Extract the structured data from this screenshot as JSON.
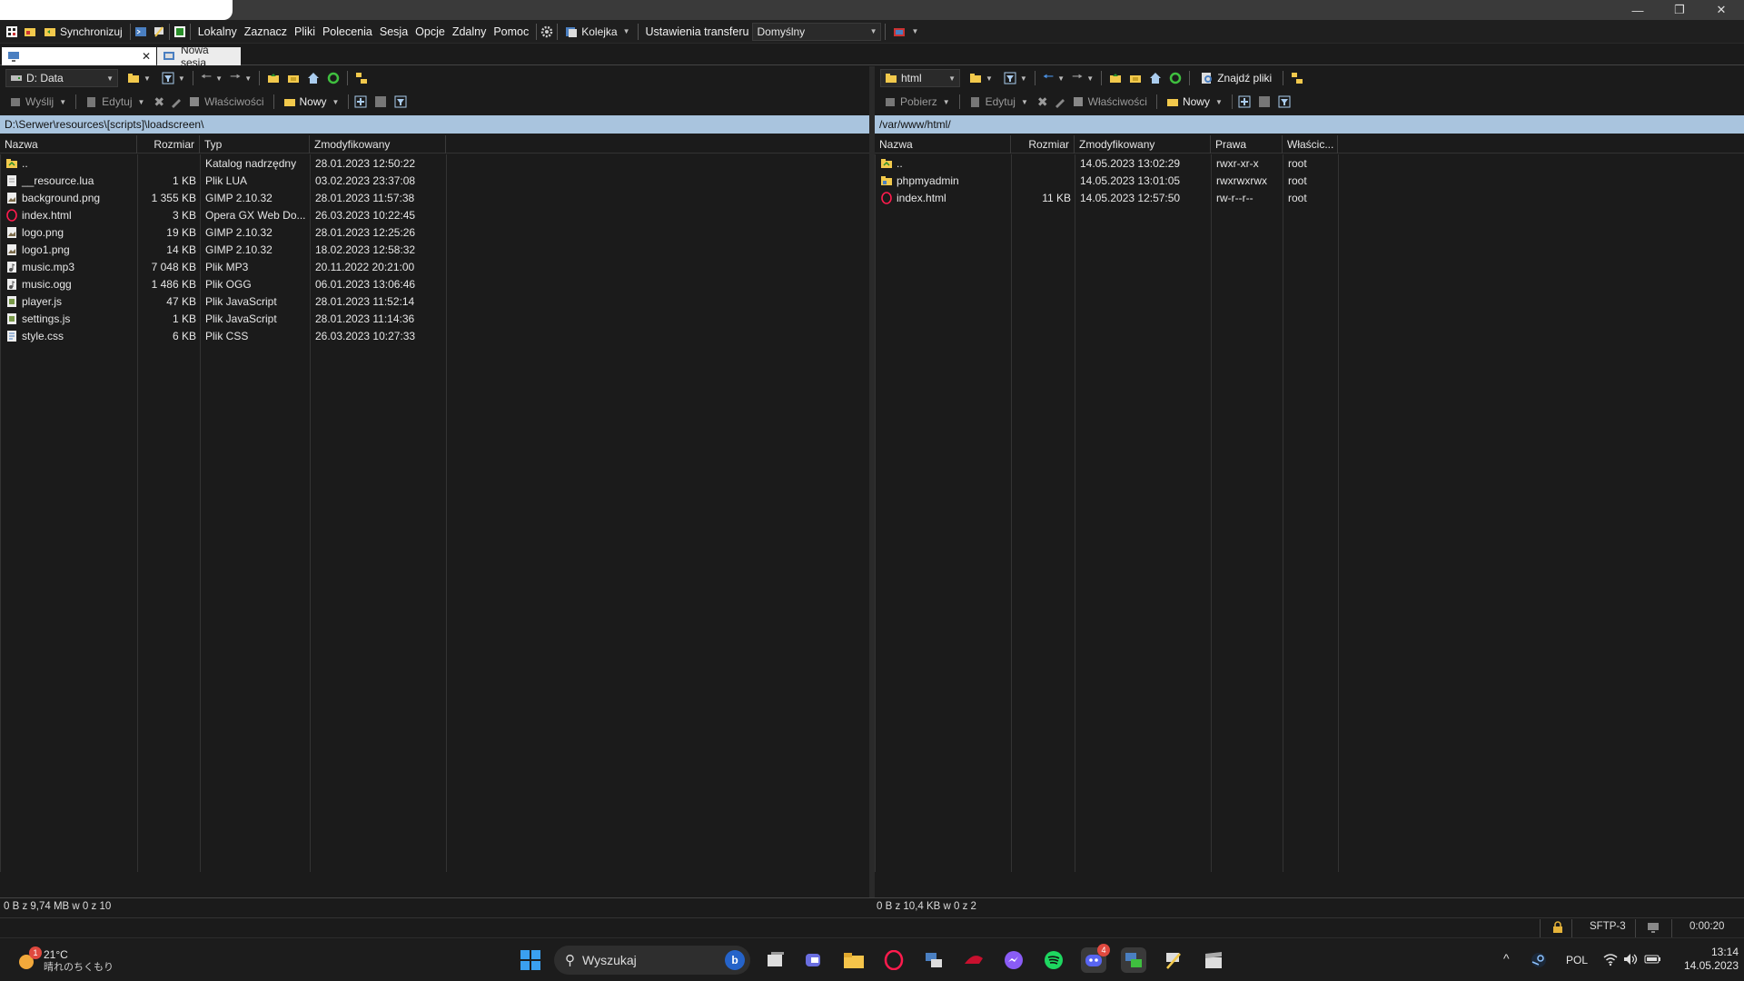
{
  "toolbar": {
    "sync_label": "Synchronizuj",
    "menu": [
      "Lokalny",
      "Zaznacz",
      "Pliki",
      "Polecenia",
      "Sesja",
      "Opcje",
      "Zdalny",
      "Pomoc"
    ],
    "queue_label": "Kolejka",
    "transfer_settings_label": "Ustawienia transferu",
    "transfer_preset": "Domyślny"
  },
  "tabs": {
    "new_session_label": "Nowa sesja"
  },
  "left": {
    "drive": "D: Data",
    "send_label": "Wyślij",
    "edit_label": "Edytuj",
    "properties_label": "Właściwości",
    "new_label": "Nowy",
    "path": "D:\\Serwer\\resources\\[scripts]\\loadscreen\\",
    "columns": [
      "Nazwa",
      "Rozmiar",
      "Typ",
      "Zmodyfikowany"
    ],
    "files": [
      {
        "name": "..",
        "size": "",
        "type": "Katalog nadrzędny",
        "modified": "28.01.2023  12:50:22",
        "icon": "parent-folder-icon"
      },
      {
        "name": "__resource.lua",
        "size": "1 KB",
        "type": "Plik LUA",
        "modified": "03.02.2023  23:37:08",
        "icon": "file-icon"
      },
      {
        "name": "background.png",
        "size": "1 355 KB",
        "type": "GIMP 2.10.32",
        "modified": "28.01.2023  11:57:38",
        "icon": "image-file-icon"
      },
      {
        "name": "index.html",
        "size": "3 KB",
        "type": "Opera GX Web Do...",
        "modified": "26.03.2023  10:22:45",
        "icon": "opera-html-icon"
      },
      {
        "name": "logo.png",
        "size": "19 KB",
        "type": "GIMP 2.10.32",
        "modified": "28.01.2023  12:25:26",
        "icon": "image-file-icon"
      },
      {
        "name": "logo1.png",
        "size": "14 KB",
        "type": "GIMP 2.10.32",
        "modified": "18.02.2023  12:58:32",
        "icon": "image-file-icon"
      },
      {
        "name": "music.mp3",
        "size": "7 048 KB",
        "type": "Plik MP3",
        "modified": "20.11.2022  20:21:00",
        "icon": "audio-file-icon"
      },
      {
        "name": "music.ogg",
        "size": "1 486 KB",
        "type": "Plik OGG",
        "modified": "06.01.2023  13:06:46",
        "icon": "audio-file-icon"
      },
      {
        "name": "player.js",
        "size": "47 KB",
        "type": "Plik JavaScript",
        "modified": "28.01.2023  11:52:14",
        "icon": "script-file-icon"
      },
      {
        "name": "settings.js",
        "size": "1 KB",
        "type": "Plik JavaScript",
        "modified": "28.01.2023  11:14:36",
        "icon": "script-file-icon"
      },
      {
        "name": "style.css",
        "size": "6 KB",
        "type": "Plik CSS",
        "modified": "26.03.2023  10:27:33",
        "icon": "css-file-icon"
      }
    ],
    "status": "0 B z 9,74 MB w 0 z 10"
  },
  "right": {
    "drive": "html",
    "download_label": "Pobierz",
    "edit_label": "Edytuj",
    "properties_label": "Właściwości",
    "new_label": "Nowy",
    "find_label": "Znajdź pliki",
    "path": "/var/www/html/",
    "columns": [
      "Nazwa",
      "Rozmiar",
      "Zmodyfikowany",
      "Prawa",
      "Właścic..."
    ],
    "files": [
      {
        "name": "..",
        "size": "",
        "modified": "14.05.2023 13:02:29",
        "rights": "rwxr-xr-x",
        "owner": "root",
        "icon": "parent-folder-icon"
      },
      {
        "name": "phpmyadmin",
        "size": "",
        "modified": "14.05.2023 13:01:05",
        "rights": "rwxrwxrwx",
        "owner": "root",
        "icon": "folder-icon"
      },
      {
        "name": "index.html",
        "size": "11 KB",
        "modified": "14.05.2023 12:57:50",
        "rights": "rw-r--r--",
        "owner": "root",
        "icon": "opera-html-icon"
      }
    ],
    "status": "0 B z 10,4 KB w 0 z 2"
  },
  "bottom": {
    "protocol": "SFTP-3",
    "timer": "0:00:20"
  },
  "taskbar": {
    "temperature": "21°C",
    "weather": "晴れのちくもり",
    "search_placeholder": "Wyszukaj",
    "language": "POL",
    "time": "13:14",
    "date": "14.05.2023",
    "weather_badge": "1",
    "discord_badge": "4"
  }
}
